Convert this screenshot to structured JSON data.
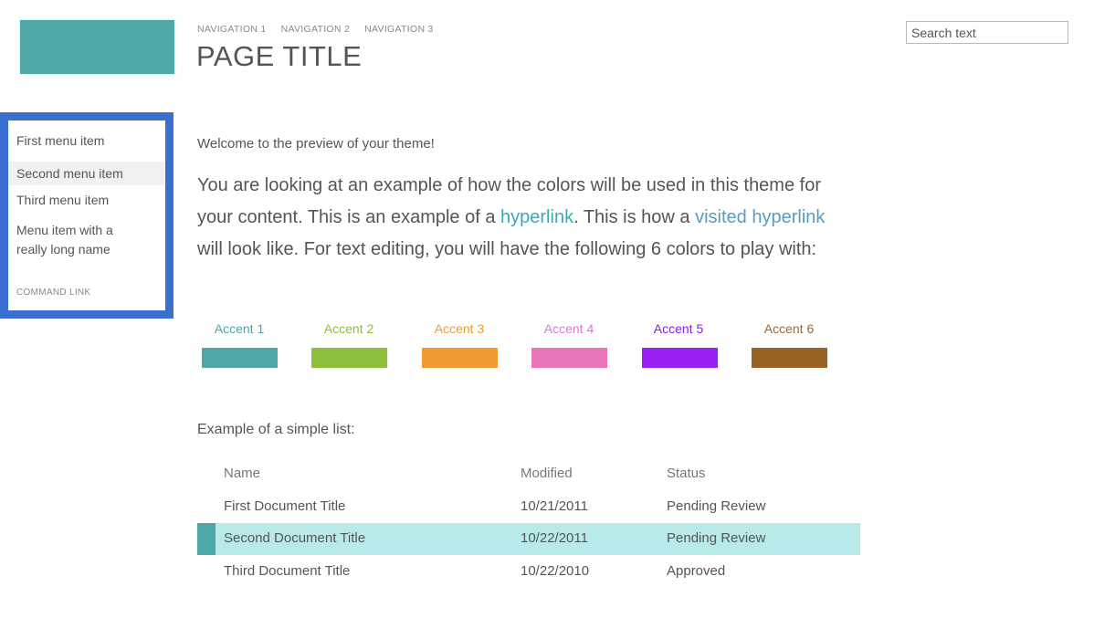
{
  "header": {
    "logo": "site-logo",
    "nav": [
      "NAVIGATION 1",
      "NAVIGATION 2",
      "NAVIGATION 3"
    ],
    "title": "PAGE TITLE",
    "search_placeholder": "Search text"
  },
  "sidebar": {
    "items": [
      {
        "label": "First menu item",
        "selected": false
      },
      {
        "label": "Second menu item",
        "selected": true
      },
      {
        "label": "Third menu item",
        "selected": false
      },
      {
        "label": "Menu item with a really long name",
        "selected": false
      }
    ],
    "command_link": "COMMAND LINK",
    "border_color": "#3a6fcf"
  },
  "content": {
    "welcome": "Welcome to the preview of your theme!",
    "intro": {
      "part1": "You are looking at an example of how the colors will be used in this theme for your content. This is an example of a ",
      "link": "hyperlink",
      "part2": ". This is how a ",
      "visited_link": "visited hyperlink",
      "part3": " will look like. For text editing, you will have the following 6 colors to play with:",
      "link_color": "#3aa8b8",
      "visited_color": "#5c9ac0"
    },
    "accents": [
      {
        "label": "Accent 1",
        "color": "#4ea8a8",
        "text_color": "#4ea8a8"
      },
      {
        "label": "Accent 2",
        "color": "#8dbf3a",
        "text_color": "#8dbf3a"
      },
      {
        "label": "Accent 3",
        "color": "#ef9a35",
        "text_color": "#ef9a35"
      },
      {
        "label": "Accent 4",
        "color": "#e875b8",
        "text_color": "#d77ad0"
      },
      {
        "label": "Accent 5",
        "color": "#9b1ff0",
        "text_color": "#8a20e0"
      },
      {
        "label": "Accent 6",
        "color": "#9a6422",
        "text_color": "#9a6a30"
      }
    ],
    "list_label": "Example of a simple list:",
    "list": {
      "columns": [
        "Name",
        "Modified",
        "Status"
      ],
      "rows": [
        {
          "name": "First Document Title",
          "modified": "10/21/2011",
          "status": "Pending Review",
          "selected": false
        },
        {
          "name": "Second Document Title",
          "modified": "10/22/2011",
          "status": "Pending Review",
          "selected": true
        },
        {
          "name": "Third Document Title",
          "modified": "10/22/2010",
          "status": "Approved",
          "selected": false
        }
      ],
      "selected_bg": "#b9eaea",
      "selected_bar": "#4ea8a8"
    }
  }
}
